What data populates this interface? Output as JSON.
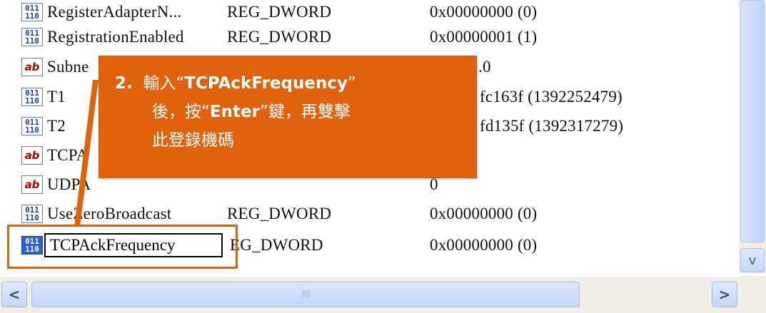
{
  "rows": [
    {
      "name": "RegisterAdapterN...",
      "type": "REG_DWORD",
      "data": "0x00000000 (0)",
      "icon": "dword-value-icon"
    },
    {
      "name": "RegistrationEnabled",
      "type": "REG_DWORD",
      "data": "0x00000001 (1)",
      "icon": "dword-value-icon"
    },
    {
      "name": "Subne",
      "type": "",
      "data": ".0",
      "icon": "string-value-icon"
    },
    {
      "name": "T1",
      "type": "",
      "data": "fc163f (1392252479)",
      "icon": "dword-value-icon"
    },
    {
      "name": "T2",
      "type": "",
      "data": "fd135f (1392317279)",
      "icon": "dword-value-icon"
    },
    {
      "name": "TCPA",
      "type": "",
      "data": "",
      "icon": "string-value-icon"
    },
    {
      "name": "UDPA",
      "type": "",
      "data": "0",
      "icon": "string-value-icon"
    },
    {
      "name": "UseZeroBroadcast",
      "type": "REG_DWORD",
      "data": "0x00000000 (0)",
      "icon": "dword-value-icon"
    },
    {
      "name": "TCPAckFrequency",
      "type": "EG_DWORD",
      "data": "0x00000000 (0)",
      "icon": "dword-value-icon"
    }
  ],
  "icon_glyphs": {
    "dword": [
      "011",
      "110"
    ],
    "string": "ab"
  },
  "callout": {
    "step": "2.",
    "line1_pre": "輸入“",
    "line1_bold": "TCPAckFrequency",
    "line1_post": "”",
    "line2_pre": "後，按“",
    "line2_bold": "Enter",
    "line2_post": "”鍵，再雙擊",
    "line3": "此登錄機碼"
  },
  "scrollbar": {
    "grip": "IIII",
    "left_arrow": "<",
    "right_arrow": ">",
    "down_arrow": "v"
  },
  "colors": {
    "callout": "#e0620c",
    "scroll": "#c5d7f8"
  }
}
